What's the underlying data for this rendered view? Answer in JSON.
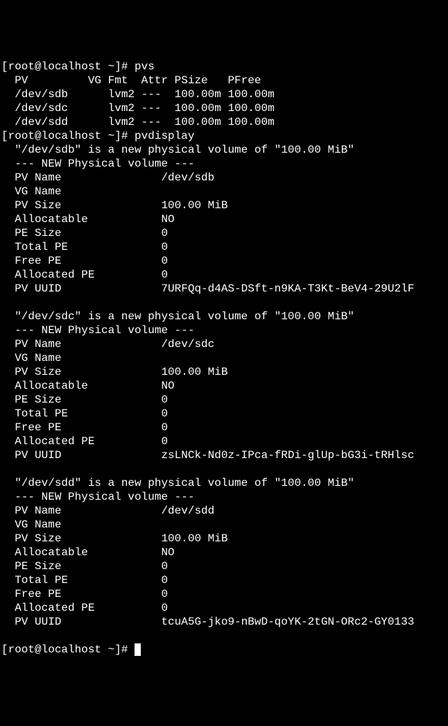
{
  "prompt1": "[root@localhost ~]# ",
  "cmd1": "pvs",
  "pvs_header": "  PV         VG Fmt  Attr PSize   PFree  ",
  "pvs_rows": [
    "  /dev/sdb      lvm2 ---  100.00m 100.00m",
    "  /dev/sdc      lvm2 ---  100.00m 100.00m",
    "  /dev/sdd      lvm2 ---  100.00m 100.00m"
  ],
  "prompt2": "[root@localhost ~]# ",
  "cmd2": "pvdisplay",
  "volumes": [
    {
      "intro": "  \"/dev/sdb\" is a new physical volume of \"100.00 MiB\"",
      "header": "  --- NEW Physical volume ---",
      "pv_name": "  PV Name               /dev/sdb",
      "vg_name": "  VG Name               ",
      "pv_size": "  PV Size               100.00 MiB",
      "allocatable": "  Allocatable           NO",
      "pe_size": "  PE Size               0   ",
      "total_pe": "  Total PE              0",
      "free_pe": "  Free PE               0",
      "allocated_pe": "  Allocated PE          0",
      "pv_uuid": "  PV UUID               7URFQq-d4AS-DSft-n9KA-T3Kt-BeV4-29U2lF",
      "blank": "   "
    },
    {
      "intro": "  \"/dev/sdc\" is a new physical volume of \"100.00 MiB\"",
      "header": "  --- NEW Physical volume ---",
      "pv_name": "  PV Name               /dev/sdc",
      "vg_name": "  VG Name               ",
      "pv_size": "  PV Size               100.00 MiB",
      "allocatable": "  Allocatable           NO",
      "pe_size": "  PE Size               0   ",
      "total_pe": "  Total PE              0",
      "free_pe": "  Free PE               0",
      "allocated_pe": "  Allocated PE          0",
      "pv_uuid": "  PV UUID               zsLNCk-Nd0z-IPca-fRDi-glUp-bG3i-tRHlsc",
      "blank": "   "
    },
    {
      "intro": "  \"/dev/sdd\" is a new physical volume of \"100.00 MiB\"",
      "header": "  --- NEW Physical volume ---",
      "pv_name": "  PV Name               /dev/sdd",
      "vg_name": "  VG Name               ",
      "pv_size": "  PV Size               100.00 MiB",
      "allocatable": "  Allocatable           NO",
      "pe_size": "  PE Size               0   ",
      "total_pe": "  Total PE              0",
      "free_pe": "  Free PE               0",
      "allocated_pe": "  Allocated PE          0",
      "pv_uuid": "  PV UUID               tcuA5G-jko9-nBwD-qoYK-2tGN-ORc2-GY0133",
      "blank": "   "
    }
  ],
  "prompt3": "[root@localhost ~]# "
}
